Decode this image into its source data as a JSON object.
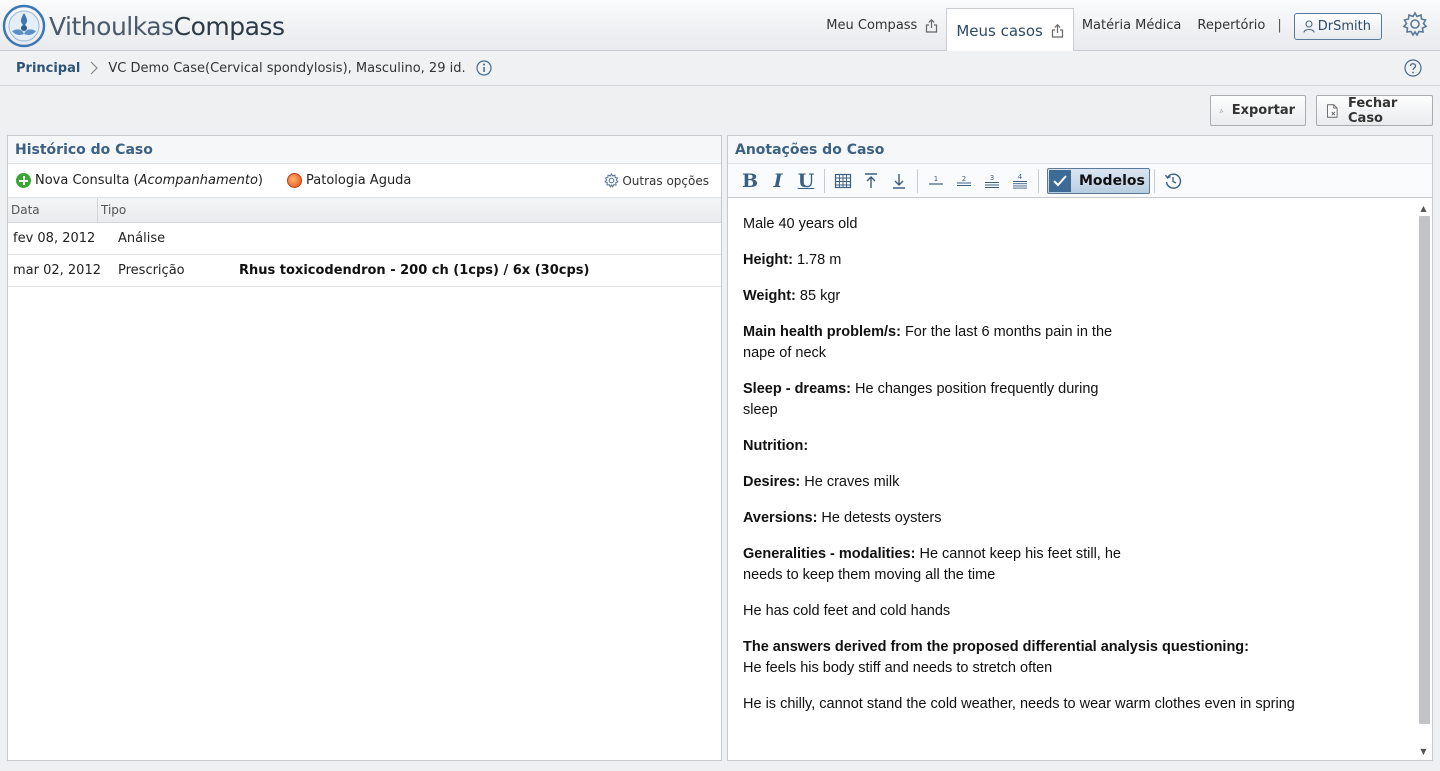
{
  "app": {
    "logo_part1": "Vithoulkas",
    "logo_part2": "Compass"
  },
  "nav": {
    "items": [
      {
        "label": "Meu Compass"
      },
      {
        "label": "Meus casos"
      },
      {
        "label": "Matéria Médica"
      },
      {
        "label": "Repertório"
      }
    ],
    "separator": "|",
    "user": "DrSmith"
  },
  "breadcrumb": {
    "home": "Principal",
    "case": "VC Demo Case(Cervical spondylosis), Masculino, 29 id."
  },
  "actions": {
    "export": "Exportar",
    "close_case": "Fechar Caso"
  },
  "history": {
    "title": "Histórico do Caso",
    "new_consult_prefix": "Nova Consulta (",
    "new_consult_italic": "Acompanhamento",
    "new_consult_suffix": ")",
    "acute": "Patologia Aguda",
    "other_options": "Outras opções",
    "col_date": "Data",
    "col_type": "Tipo",
    "rows": [
      {
        "date": "fev 08, 2012",
        "type": "Análise",
        "detail": ""
      },
      {
        "date": "mar 02, 2012",
        "type": "Prescrição",
        "detail": "Rhus toxicodendron - 200 ch (1cps) / 6x (30cps)"
      }
    ]
  },
  "notes": {
    "title": "Anotações do Caso",
    "models_label": "Modelos",
    "toolbar": {
      "sup1": "1",
      "sup2": "2",
      "sup3": "3",
      "sup4": "4"
    },
    "paragraphs": [
      {
        "label": "",
        "text": "Male 40 years old"
      },
      {
        "label": "Height:",
        "text": " 1.78 m"
      },
      {
        "label": "Weight:",
        "text": " 85 kgr"
      },
      {
        "label": "Main health problem/s:",
        "text": " For the last 6 months pain in the nape of neck"
      },
      {
        "label": "Sleep - dreams:",
        "text": " He changes position frequently during sleep"
      },
      {
        "label": "Nutrition:",
        "text": ""
      },
      {
        "label": "Desires:",
        "text": " He craves milk"
      },
      {
        "label": "Aversions:",
        "text": " He detests oysters"
      },
      {
        "label": "Generalities - modalities:",
        "text": " He cannot keep his feet still, he needs to keep them moving all the time"
      },
      {
        "label": "",
        "text": "He has cold feet and cold hands"
      },
      {
        "label": "The answers derived from the proposed differential analysis questioning:",
        "text": "He feels his body stiff and needs to stretch often"
      },
      {
        "label": "",
        "text": "He is chilly, cannot stand the cold weather, needs to wear warm clothes even in spring"
      }
    ]
  },
  "colors": {
    "accent": "#3b6184",
    "link": "#2e5477",
    "add_green": "#3aa635",
    "acute_orange": "#e34a1c"
  }
}
